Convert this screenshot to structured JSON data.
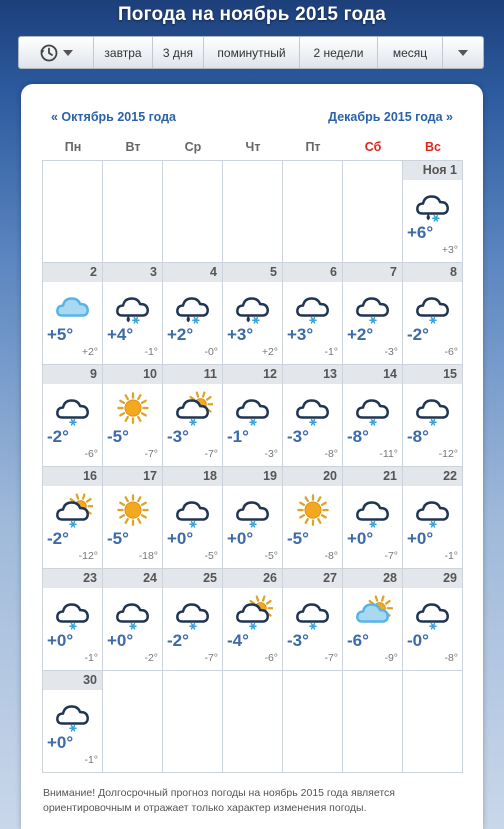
{
  "page": {
    "title": "Погода на ноябрь 2015 года"
  },
  "nav": {
    "history_icon": "history-clock-icon",
    "tabs": [
      {
        "label": "завтра"
      },
      {
        "label": "3 дня"
      },
      {
        "label": "поминутный"
      },
      {
        "label": "2 недели"
      },
      {
        "label": "месяц"
      }
    ],
    "more_icon": "chevron-down-icon"
  },
  "calendar": {
    "prev_month": "« Октябрь 2015 года",
    "next_month": "Декабрь 2015 года »",
    "weekdays": [
      "Пн",
      "Вт",
      "Ср",
      "Чт",
      "Пт",
      "Сб",
      "Вс"
    ],
    "weekend_color": "#e0261b",
    "temp_color": "#3c6ba8",
    "days": [
      {
        "day": "Ноя 1",
        "icon": "rain-snow-cloud",
        "max": "+6°",
        "min": "+3°"
      },
      {
        "day": "2",
        "icon": "cloud",
        "max": "+5°",
        "min": "+2°"
      },
      {
        "day": "3",
        "icon": "rain-snow-cloud",
        "max": "+4°",
        "min": "-1°"
      },
      {
        "day": "4",
        "icon": "rain-snow-cloud",
        "max": "+2°",
        "min": "-0°"
      },
      {
        "day": "5",
        "icon": "rain-snow-cloud",
        "max": "+3°",
        "min": "+2°"
      },
      {
        "day": "6",
        "icon": "snow-cloud",
        "max": "+3°",
        "min": "-1°"
      },
      {
        "day": "7",
        "icon": "snow-cloud",
        "max": "+2°",
        "min": "-3°"
      },
      {
        "day": "8",
        "icon": "snow-cloud",
        "max": "-2°",
        "min": "-6°"
      },
      {
        "day": "9",
        "icon": "snow-cloud",
        "max": "-2°",
        "min": "-6°"
      },
      {
        "day": "10",
        "icon": "sun",
        "max": "-5°",
        "min": "-7°"
      },
      {
        "day": "11",
        "icon": "sun-snow-cloud",
        "max": "-3°",
        "min": "-7°"
      },
      {
        "day": "12",
        "icon": "snow-cloud",
        "max": "-1°",
        "min": "-3°"
      },
      {
        "day": "13",
        "icon": "snow-cloud",
        "max": "-3°",
        "min": "-8°"
      },
      {
        "day": "14",
        "icon": "snow-cloud",
        "max": "-8°",
        "min": "-11°"
      },
      {
        "day": "15",
        "icon": "snow-cloud",
        "max": "-8°",
        "min": "-12°"
      },
      {
        "day": "16",
        "icon": "sun-snow-cloud",
        "max": "-2°",
        "min": "-12°"
      },
      {
        "day": "17",
        "icon": "sun",
        "max": "-5°",
        "min": "-18°"
      },
      {
        "day": "18",
        "icon": "snow-cloud",
        "max": "+0°",
        "min": "-5°"
      },
      {
        "day": "19",
        "icon": "snow-cloud",
        "max": "+0°",
        "min": "-5°"
      },
      {
        "day": "20",
        "icon": "sun",
        "max": "-5°",
        "min": "-8°"
      },
      {
        "day": "21",
        "icon": "snow-cloud",
        "max": "+0°",
        "min": "-7°"
      },
      {
        "day": "22",
        "icon": "snow-cloud",
        "max": "+0°",
        "min": "-1°"
      },
      {
        "day": "23",
        "icon": "snow-cloud",
        "max": "+0°",
        "min": "-1°"
      },
      {
        "day": "24",
        "icon": "snow-cloud",
        "max": "+0°",
        "min": "-2°"
      },
      {
        "day": "25",
        "icon": "snow-cloud",
        "max": "-2°",
        "min": "-7°"
      },
      {
        "day": "26",
        "icon": "sun-snow-cloud",
        "max": "-4°",
        "min": "-6°"
      },
      {
        "day": "27",
        "icon": "snow-cloud",
        "max": "-3°",
        "min": "-7°"
      },
      {
        "day": "28",
        "icon": "sun-cloud",
        "max": "-6°",
        "min": "-9°"
      },
      {
        "day": "29",
        "icon": "snow-cloud",
        "max": "-0°",
        "min": "-8°"
      },
      {
        "day": "30",
        "icon": "snow-cloud",
        "max": "+0°",
        "min": "-1°"
      }
    ]
  },
  "notice": "Внимание! Долгосрочный прогноз погоды на ноябрь 2015 года является ориентировочным и отражает только характер изменения погоды."
}
